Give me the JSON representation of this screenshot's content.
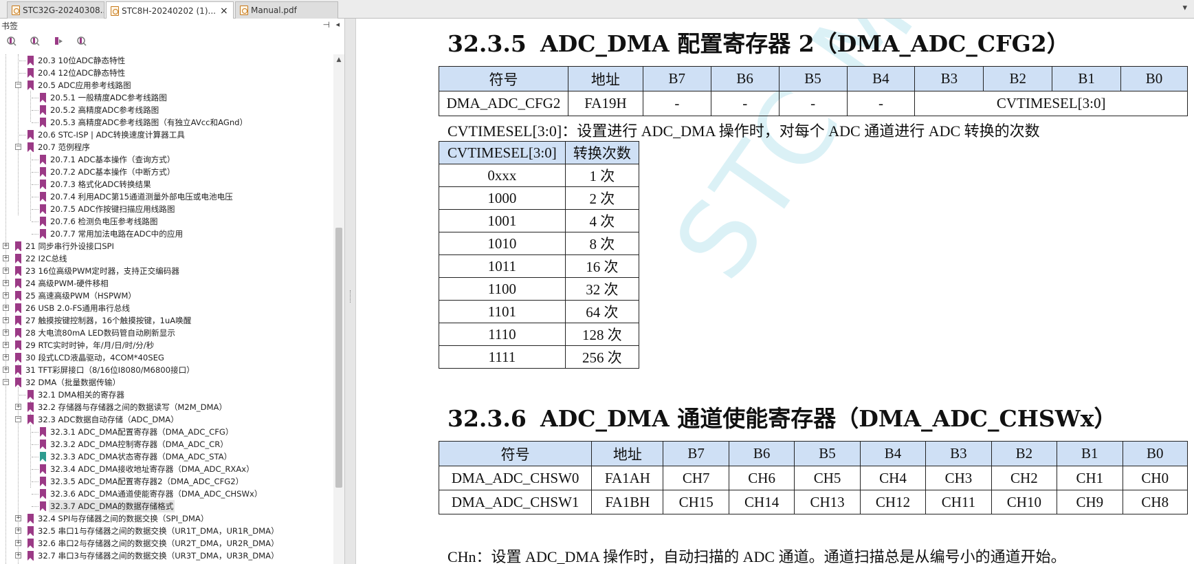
{
  "tabs": [
    {
      "label": "STC32G-20240308...",
      "active": false
    },
    {
      "label": "STC8H-20240202 (1)...",
      "active": true
    },
    {
      "label": "Manual.pdf",
      "active": false
    }
  ],
  "tab_close_glyph": "×",
  "tab_menu_glyph": "▾",
  "sidebar": {
    "title": "书签",
    "pin_glyph": "⊣",
    "close_glyph": "◂",
    "toolbar_icons": [
      "bookmark-expand-icon",
      "bookmark-collapse-icon",
      "bookmark-add-icon",
      "bookmark-find-icon"
    ],
    "items": [
      {
        "label": "20.3  10位ADC静态特性",
        "level": 1
      },
      {
        "label": "20.4 12位ADC静态特性",
        "level": 1
      },
      {
        "label": "20.5  ADC应用参考线路图",
        "level": 1,
        "expander": "minus"
      },
      {
        "label": "20.5.1 一般精度ADC参考线路图",
        "level": 2
      },
      {
        "label": "20.5.2  高精度ADC参考线路图",
        "level": 2
      },
      {
        "label": "20.5.3  高精度ADC参考线路图（有独立AVcc和AGnd）",
        "level": 2
      },
      {
        "label": "20.6  STC-ISP | ADC转换速度计算器工具",
        "level": 1
      },
      {
        "label": "20.7  范例程序",
        "level": 1,
        "expander": "minus"
      },
      {
        "label": "20.7.1 ADC基本操作（查询方式）",
        "level": 2
      },
      {
        "label": "20.7.2 ADC基本操作（中断方式）",
        "level": 2
      },
      {
        "label": "20.7.3 格式化ADC转换结果",
        "level": 2
      },
      {
        "label": "20.7.4 利用ADC第15通道测量外部电压或电池电压",
        "level": 2
      },
      {
        "label": "20.7.5 ADC作按键扫描应用线路图",
        "level": 2
      },
      {
        "label": "20.7.6  检测负电压参考线路图",
        "level": 2
      },
      {
        "label": "20.7.7  常用加法电路在ADC中的应用",
        "level": 2
      },
      {
        "label": "21  同步串行外设接口SPI",
        "level": 0,
        "expander": "plus"
      },
      {
        "label": "22  I2C总线",
        "level": 0,
        "expander": "plus"
      },
      {
        "label": "23  16位高级PWM定时器，支持正交编码器",
        "level": 0,
        "expander": "plus"
      },
      {
        "label": "24  高级PWM-硬件移相",
        "level": 0,
        "expander": "plus"
      },
      {
        "label": "25  高速高级PWM（HSPWM）",
        "level": 0,
        "expander": "plus"
      },
      {
        "label": "26  USB 2.0-FS通用串行总线",
        "level": 0,
        "expander": "plus"
      },
      {
        "label": "27  触摸按键控制器，16个触摸按键，1uA唤醒",
        "level": 0,
        "expander": "plus"
      },
      {
        "label": "28  大电流80mA  LED数码管自动刷新显示",
        "level": 0,
        "expander": "plus"
      },
      {
        "label": "29  RTC实时时钟，年/月/日/时/分/秒",
        "level": 0,
        "expander": "plus"
      },
      {
        "label": "30  段式LCD液晶驱动，4COM*40SEG",
        "level": 0,
        "expander": "plus"
      },
      {
        "label": "31  TFT彩屏接口（8/16位I8080/M6800接口）",
        "level": 0,
        "expander": "plus"
      },
      {
        "label": "32  DMA（批量数据传输）",
        "level": 0,
        "expander": "minus"
      },
      {
        "label": "32.1 DMA相关的寄存器",
        "level": 1
      },
      {
        "label": "32.2 存储器与存储器之间的数据读写（M2M_DMA）",
        "level": 1,
        "expander": "plus"
      },
      {
        "label": "32.3 ADC数据自动存储（ADC_DMA）",
        "level": 1,
        "expander": "minus"
      },
      {
        "label": "32.3.1 ADC_DMA配置寄存器（DMA_ADC_CFG）",
        "level": 2
      },
      {
        "label": "32.3.2 ADC_DMA控制寄存器（DMA_ADC_CR）",
        "level": 2
      },
      {
        "label": "32.3.3  ADC_DMA状态寄存器（DMA_ADC_STA）",
        "level": 2,
        "teal": true
      },
      {
        "label": "32.3.4 ADC_DMA接收地址寄存器（DMA_ADC_RXAx）",
        "level": 2
      },
      {
        "label": "32.3.5 ADC_DMA配置寄存器2（DMA_ADC_CFG2）",
        "level": 2
      },
      {
        "label": "32.3.6 ADC_DMA通道使能寄存器（DMA_ADC_CHSWx）",
        "level": 2
      },
      {
        "label": "32.3.7  ADC_DMA的数据存储格式",
        "level": 2,
        "selected": true
      },
      {
        "label": "32.4  SPI与存储器之间的数据交换（SPI_DMA）",
        "level": 1,
        "expander": "plus"
      },
      {
        "label": "32.5  串口1与存储器之间的数据交换（UR1T_DMA，UR1R_DMA）",
        "level": 1,
        "expander": "plus"
      },
      {
        "label": "32.6 串口2与存储器之间的数据交换（UR2T_DMA，UR2R_DMA）",
        "level": 1,
        "expander": "plus"
      },
      {
        "label": "32.7 串口3与存储器之间的数据交换（UR3T_DMA，UR3R_DMA）",
        "level": 1,
        "expander": "plus"
      }
    ]
  },
  "document": {
    "watermark": "STC MCU",
    "section1": {
      "number": "32.3.5",
      "title": "ADC_DMA 配置寄存器 2（DMA_ADC_CFG2）",
      "table": {
        "headers": [
          "符号",
          "地址",
          "B7",
          "B6",
          "B5",
          "B4",
          "B3",
          "B2",
          "B1",
          "B0"
        ],
        "row": [
          "DMA_ADC_CFG2",
          "FA19H",
          "-",
          "-",
          "-",
          "-",
          "CVTIMESEL[3:0]"
        ]
      },
      "description": "CVTIMESEL[3:0]：设置进行 ADC_DMA 操作时，对每个 ADC 通道进行 ADC 转换的次数",
      "value_table": {
        "headers": [
          "CVTIMESEL[3:0]",
          "转换次数"
        ],
        "rows": [
          [
            "0xxx",
            "1 次"
          ],
          [
            "1000",
            "2 次"
          ],
          [
            "1001",
            "4 次"
          ],
          [
            "1010",
            "8 次"
          ],
          [
            "1011",
            "16 次"
          ],
          [
            "1100",
            "32 次"
          ],
          [
            "1101",
            "64 次"
          ],
          [
            "1110",
            "128 次"
          ],
          [
            "1111",
            "256 次"
          ]
        ]
      }
    },
    "section2": {
      "number": "32.3.6",
      "title": "ADC_DMA 通道使能寄存器（DMA_ADC_CHSWx）",
      "table": {
        "headers": [
          "符号",
          "地址",
          "B7",
          "B6",
          "B5",
          "B4",
          "B3",
          "B2",
          "B1",
          "B0"
        ],
        "rows": [
          [
            "DMA_ADC_CHSW0",
            "FA1AH",
            "CH7",
            "CH6",
            "CH5",
            "CH4",
            "CH3",
            "CH2",
            "CH1",
            "CH0"
          ],
          [
            "DMA_ADC_CHSW1",
            "FA1BH",
            "CH15",
            "CH14",
            "CH13",
            "CH12",
            "CH11",
            "CH10",
            "CH9",
            "CH8"
          ]
        ]
      },
      "description": "CHn：设置 ADC_DMA 操作时，自动扫描的 ADC 通道。通道扫描总是从编号小的通道开始。"
    }
  },
  "colors": {
    "table_header": "#cfe0f5",
    "bookmark_icon": "#9b3a86",
    "bookmark_icon_current": "#2d9c8f",
    "watermark": "#bfe6f0"
  }
}
